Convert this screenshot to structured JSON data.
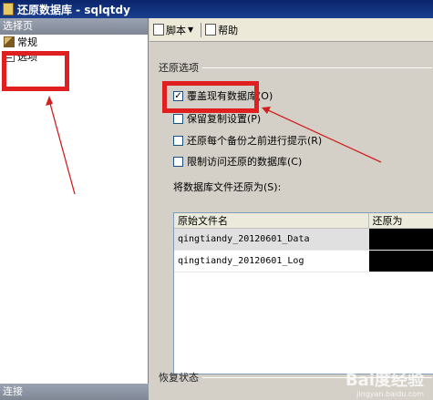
{
  "window": {
    "title": "还原数据库 - sqlqtdy"
  },
  "sidebar": {
    "header": "选择页",
    "items": [
      {
        "label": "常规",
        "icon": "general-page-icon"
      },
      {
        "label": "选项",
        "icon": "options-page-icon"
      }
    ],
    "footer": "连接"
  },
  "toolbar": {
    "script_label": "脚本",
    "help_label": "帮助"
  },
  "restore_options": {
    "title": "还原选项",
    "options": [
      {
        "label": "覆盖现有数据库(O)",
        "checked": true
      },
      {
        "label": "保留复制设置(P)",
        "checked": false
      },
      {
        "label": "还原每个备份之前进行提示(R)",
        "checked": false
      },
      {
        "label": "限制访问还原的数据库(C)",
        "checked": false
      }
    ],
    "files_label": "将数据库文件还原为(S):"
  },
  "files_table": {
    "columns": [
      "原始文件名",
      "还原为"
    ],
    "rows": [
      {
        "original": "qingtiandy_20120601_Data",
        "restore_to": ""
      },
      {
        "original": "qingtiandy_20120601_Log",
        "restore_to": ""
      }
    ]
  },
  "recovery_state": {
    "title": "恢复状态"
  },
  "watermark": {
    "text": "Bai度经验",
    "sub": "jingyan.baidu.com"
  },
  "colors": {
    "highlight": "#e02020",
    "title_bar": "#0a246a"
  }
}
